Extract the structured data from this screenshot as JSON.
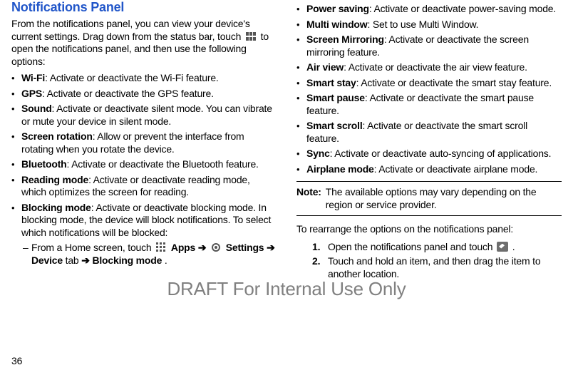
{
  "header": {
    "title": "Notifications Panel"
  },
  "intro": {
    "part1": "From the notifications panel, you can view your device's current settings. Drag down from the status bar, touch ",
    "part2": " to open the notifications panel, and then use the following options:"
  },
  "left_bullets": [
    {
      "term": "Wi-Fi",
      "desc": ": Activate or deactivate the Wi-Fi feature."
    },
    {
      "term": "GPS",
      "desc": ": Activate or deactivate the GPS feature."
    },
    {
      "term": "Sound",
      "desc": ": Activate or deactivate silent mode. You can vibrate or mute your device in silent mode."
    },
    {
      "term": "Screen rotation",
      "desc": ": Allow or prevent the interface from rotating when you rotate the device."
    },
    {
      "term": "Bluetooth",
      "desc": ": Activate or deactivate the Bluetooth feature."
    },
    {
      "term": "Reading mode",
      "desc": ": Activate or deactivate reading mode, which optimizes the screen for reading."
    },
    {
      "term": "Blocking mode",
      "desc": ": Activate or deactivate blocking mode. In blocking mode, the device will block notifications. To select which notifications will be blocked:"
    }
  ],
  "blocking_sub": {
    "pre": "From a Home screen, touch ",
    "apps": "Apps",
    "arrow": " ➔ ",
    "settings": "Settings",
    "arrow2": " ➔ ",
    "devicetab": "Device",
    "tab": " tab ",
    "arrow3": "➔ ",
    "blockingmode": "Blocking mode",
    "period": "."
  },
  "right_bullets": [
    {
      "term": "Power saving",
      "desc": ": Activate or deactivate power-saving mode."
    },
    {
      "term": "Multi window",
      "desc": ": Set to use Multi Window."
    },
    {
      "term": "Screen Mirroring",
      "desc": ": Activate or deactivate the screen mirroring feature."
    },
    {
      "term": "Air view",
      "desc": ": Activate or deactivate the air view feature."
    },
    {
      "term": "Smart stay",
      "desc": ": Activate or deactivate the smart stay feature."
    },
    {
      "term": "Smart pause",
      "desc": ": Activate or deactivate the smart pause feature."
    },
    {
      "term": "Smart scroll",
      "desc": ": Activate or deactivate the smart scroll feature."
    },
    {
      "term": "Sync",
      "desc": ": Activate or deactivate auto-syncing of applications."
    },
    {
      "term": "Airplane mode",
      "desc": ": Activate or deactivate airplane mode."
    }
  ],
  "note": {
    "label": "Note:",
    "text": "The available options may vary depending on the region or service provider."
  },
  "rearrange": {
    "intro": "To rearrange the options on the notifications panel:",
    "steps": [
      {
        "n": "1.",
        "pre": "Open the notifications panel and touch ",
        "post": "."
      },
      {
        "n": "2.",
        "text": "Touch and hold an item, and then drag the item to another location."
      }
    ]
  },
  "watermark": "DRAFT For Internal Use Only",
  "page_number": "36"
}
